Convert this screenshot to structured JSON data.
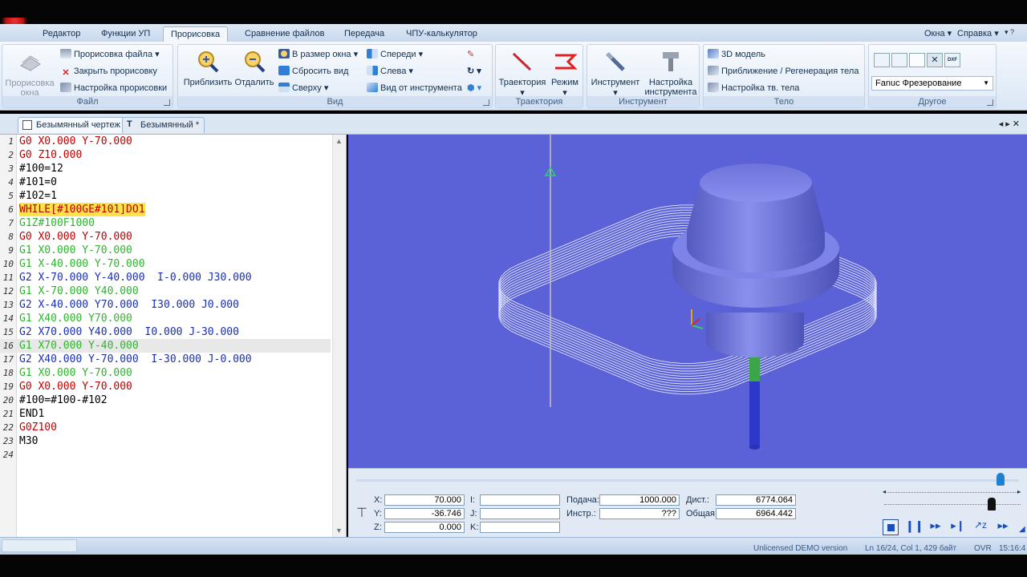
{
  "menu": {
    "tabs": [
      "Редактор",
      "Функции УП",
      "Прорисовка",
      "Сравнение файлов",
      "Передача",
      "ЧПУ-калькулятор"
    ],
    "active_tab": "Прорисовка",
    "right": {
      "windows": "Окна",
      "help": "Справка"
    }
  },
  "ribbon": {
    "file": {
      "label": "Файл",
      "draw_big": "Прорисовка окна",
      "draw_file": "Прорисовка файла",
      "close_draw": "Закрыть прорисовку",
      "draw_settings": "Настройка прорисовки"
    },
    "view": {
      "label": "Вид",
      "zoom_in": "Приблизить",
      "zoom_out": "Отдалить",
      "fit": "В размер окна",
      "reset": "Сбросить вид",
      "top": "Сверху",
      "front": "Спереди",
      "left": "Слева",
      "from_tool": "Вид от инструмента"
    },
    "trajectory": {
      "label": "Траектория",
      "trajectory": "Траектория",
      "mode": "Режим"
    },
    "tool": {
      "label": "Инструмент",
      "tool": "Инструмент",
      "setup": "Настройка инструмента"
    },
    "body": {
      "label": "Тело",
      "model3d": "3D модель",
      "zoom_regen": "Приближение / Регенерация тела",
      "body_setup": "Настройка тв. тела"
    },
    "other": {
      "label": "Другое",
      "machine": "Fanuc Фрезерование"
    }
  },
  "doc_tabs": [
    "Безымянный чертеж *",
    "Безымянный *"
  ],
  "editor": {
    "current_line": 16,
    "lines": [
      {
        "n": "1",
        "t": "G0 X0.000 Y-70.000",
        "c": "#c00000"
      },
      {
        "n": "2",
        "t": "G0 Z10.000",
        "c": "#c00000"
      },
      {
        "n": "3",
        "t": "#100=12",
        "c": "#000000"
      },
      {
        "n": "4",
        "t": "#101=0",
        "c": "#000000"
      },
      {
        "n": "5",
        "t": "#102=1",
        "c": "#000000"
      },
      {
        "n": "6",
        "t": "WHILE[#100GE#101]DO1",
        "c": "#c00000"
      },
      {
        "n": "7",
        "t": "G1Z#100F1000",
        "c": "#2db52d"
      },
      {
        "n": "8",
        "t": "G0 X0.000 Y-70.000",
        "c": "#c00000"
      },
      {
        "n": "9",
        "t": "G1 X0.000 Y-70.000",
        "c": "#2db52d"
      },
      {
        "n": "10",
        "t": "G1 X-40.000 Y-70.000",
        "c": "#2db52d"
      },
      {
        "n": "11",
        "t": "G2 X-70.000 Y-40.000  I-0.000 J30.000",
        "c": "#1a2fb0"
      },
      {
        "n": "12",
        "t": "G1 X-70.000 Y40.000",
        "c": "#2db52d"
      },
      {
        "n": "13",
        "t": "G2 X-40.000 Y70.000  I30.000 J0.000",
        "c": "#1a2fb0"
      },
      {
        "n": "14",
        "t": "G1 X40.000 Y70.000",
        "c": "#2db52d"
      },
      {
        "n": "15",
        "t": "G2 X70.000 Y40.000  I0.000 J-30.000",
        "c": "#1a2fb0"
      },
      {
        "n": "16",
        "t": "G1 X70.000 Y-40.000",
        "c": "#2db52d"
      },
      {
        "n": "17",
        "t": "G2 X40.000 Y-70.000  I-30.000 J-0.000",
        "c": "#1a2fb0"
      },
      {
        "n": "18",
        "t": "G1 X0.000 Y-70.000",
        "c": "#2db52d"
      },
      {
        "n": "19",
        "t": "G0 X0.000 Y-70.000",
        "c": "#c00000"
      },
      {
        "n": "20",
        "t": "#100=#100-#102",
        "c": "#000000"
      },
      {
        "n": "21",
        "t": "END1",
        "c": "#000000"
      },
      {
        "n": "22",
        "t": "G0Z100",
        "c": "#c00000"
      },
      {
        "n": "23",
        "t": "M30",
        "c": "#000000"
      },
      {
        "n": "24",
        "t": "",
        "c": "#000000"
      }
    ]
  },
  "coords": {
    "x_label": "X:",
    "x": "70.000",
    "y_label": "Y:",
    "y": "-36.746",
    "z_label": "Z:",
    "z": "0.000",
    "i_label": "I:",
    "j_label": "J:",
    "k_label": "K:",
    "feed_label": "Подача:",
    "feed": "1000.000",
    "tool_label": "Инстр.:",
    "tool": "???",
    "dist_label": "Дист.:",
    "dist": "6774.064",
    "total_label": "Общая:",
    "total": "6964.442"
  },
  "status": {
    "license": "Unlicensed DEMO version",
    "position": "Ln 16/24, Col 1, 429 байт",
    "ovr": "OVR",
    "time": "15:16:4"
  },
  "colors": {
    "viewport": "#5b61d6",
    "toolpath": "#dfe3ff",
    "tool_body": "#7b82e6"
  }
}
